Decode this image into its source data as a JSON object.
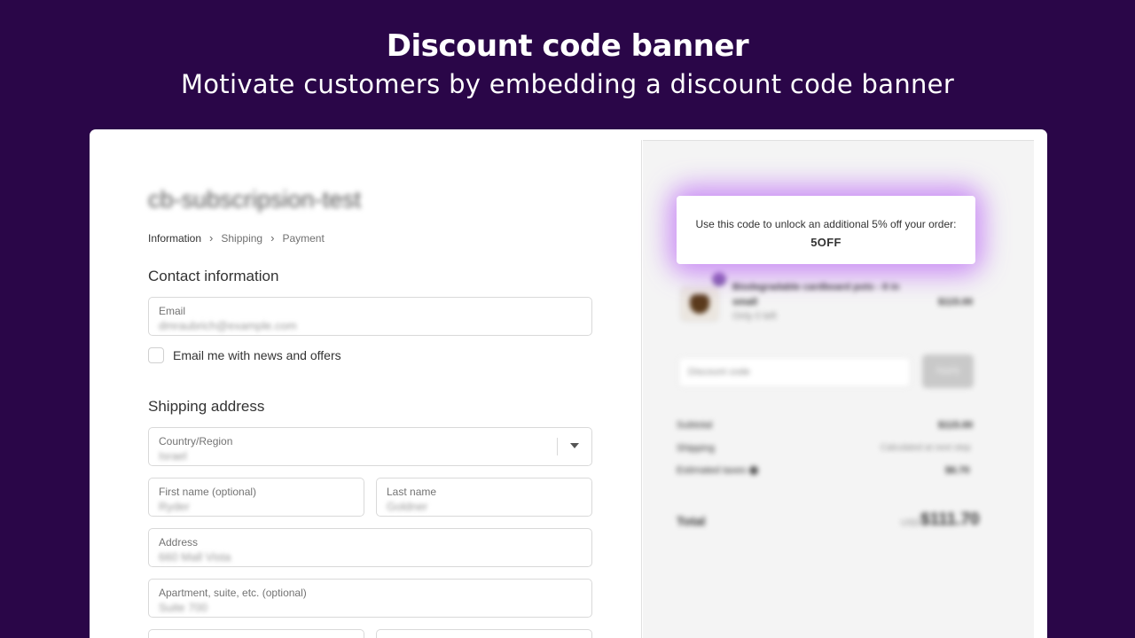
{
  "hero": {
    "title": "Discount code banner",
    "subtitle": "Motivate customers by embedding a discount code banner"
  },
  "store": {
    "name": "cb-subscripsion-test"
  },
  "breadcrumb": {
    "steps": [
      "Information",
      "Shipping",
      "Payment"
    ],
    "separator": "›"
  },
  "contact": {
    "title": "Contact information",
    "email_label": "Email",
    "email_value": "dmraubrich@example.com",
    "newsletter_label": "Email me with news and offers"
  },
  "shipping": {
    "title": "Shipping address",
    "country_label": "Country/Region",
    "country_value": "Israel",
    "first_name_label": "First name (optional)",
    "first_name_value": "Ryder",
    "last_name_label": "Last name",
    "last_name_value": "Goldner",
    "address_label": "Address",
    "address_value": "660 Mall Vista",
    "apartment_label": "Apartment, suite, etc. (optional)",
    "apartment_value": "Suite 700"
  },
  "banner": {
    "message": "Use this code to unlock an additional 5% off your order:",
    "code": "5OFF",
    "glow_color": "#be6ef5"
  },
  "summary": {
    "product_name": "Biodegradable cardboard pots - 8 in",
    "product_variant": "small",
    "product_stock": "Only 0 left",
    "product_price": "$115.00",
    "discount_placeholder": "Discount code",
    "apply_label": "Apply",
    "subtotal_label": "Subtotal",
    "subtotal_value": "$115.00",
    "shipping_label": "Shipping",
    "shipping_value": "Calculated at next step",
    "taxes_label": "Estimated taxes",
    "taxes_value": "$6.70",
    "total_label": "Total",
    "total_currency": "USD",
    "total_value": "$111.70"
  },
  "colors": {
    "background": "#2a0648",
    "banner_bg": "#ffffff",
    "summary_bg": "#f4f4f4"
  }
}
